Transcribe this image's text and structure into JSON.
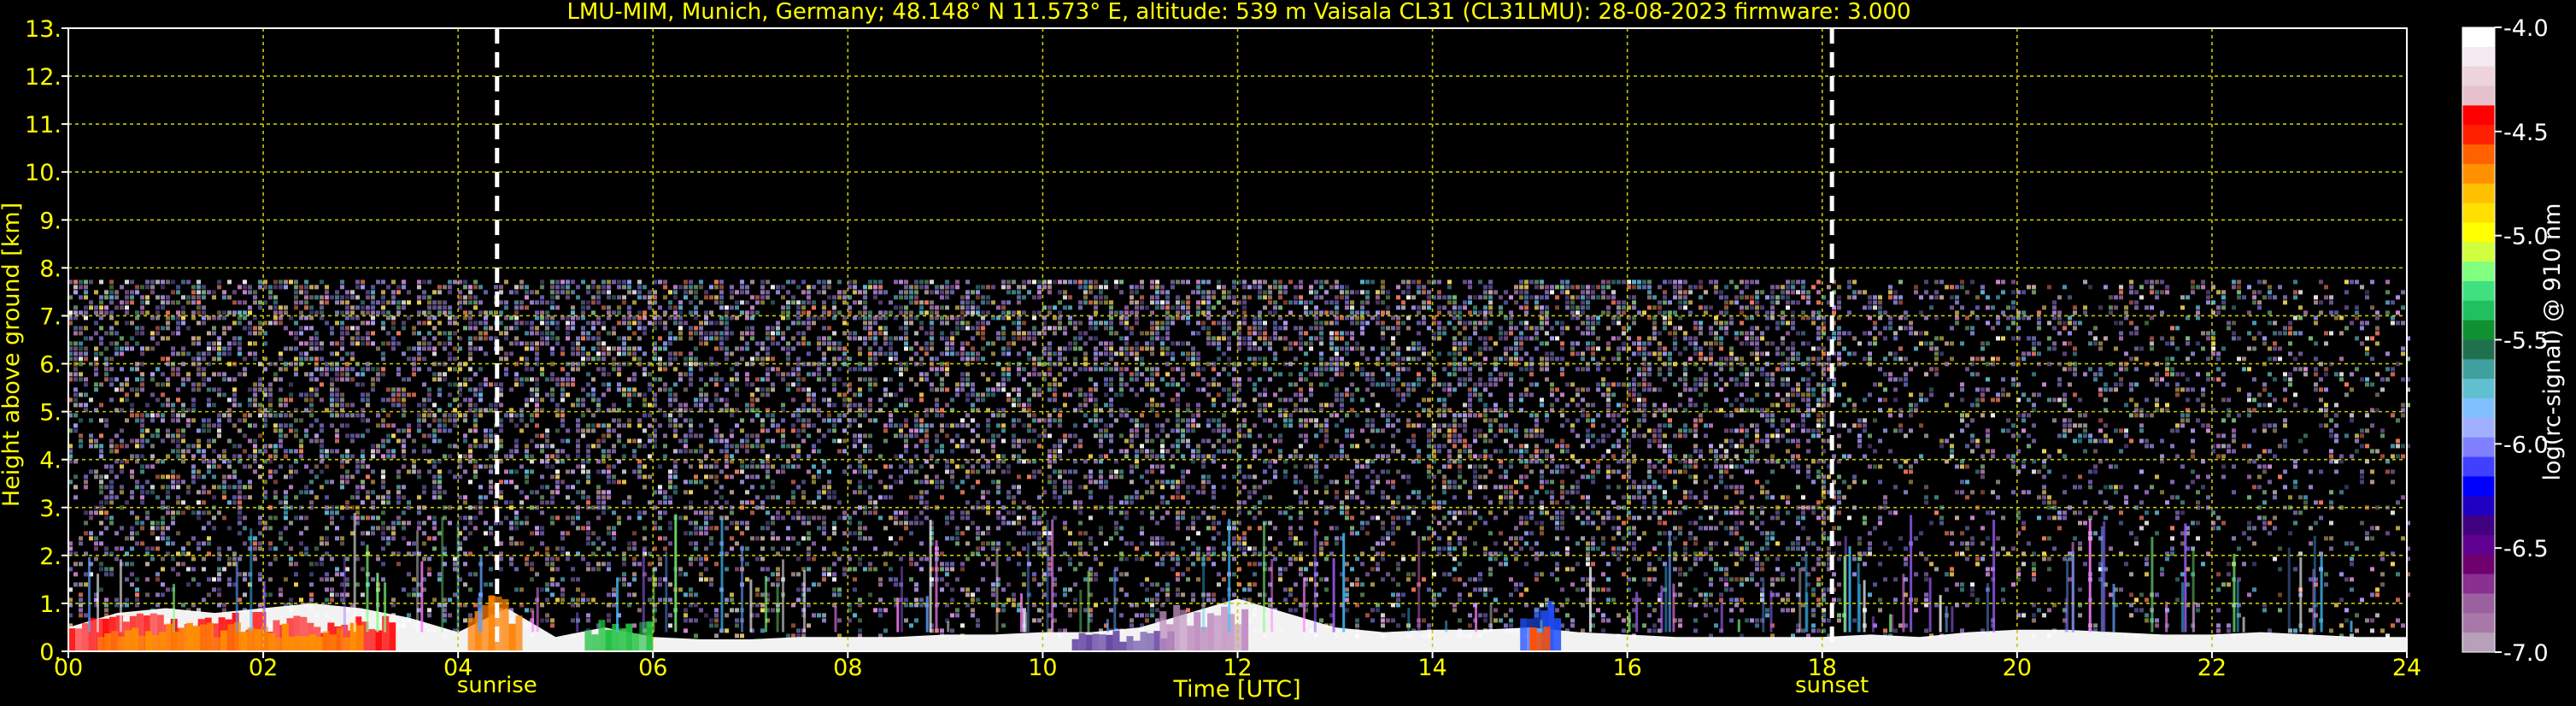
{
  "chart_data": {
    "type": "heatmap",
    "title": "LMU-MIM, Munich, Germany; 48.148° N 11.573° E, altitude: 539 m    Vaisala CL31 (CL31LMU): 28-08-2023    firmware: 3.000",
    "xlabel": "Time [UTC]",
    "ylabel": "Height above ground [km]",
    "xlim": [
      0,
      24
    ],
    "ylim": [
      0,
      13
    ],
    "x_ticks": [
      "00",
      "02",
      "04",
      "06",
      "08",
      "10",
      "12",
      "14",
      "16",
      "18",
      "20",
      "22",
      "24"
    ],
    "y_ticks": [
      "0.",
      "1.",
      "2.",
      "3.",
      "4.",
      "5.",
      "6.",
      "7.",
      "8.",
      "9.",
      "10.",
      "11.",
      "12.",
      "13."
    ],
    "grid": true,
    "colorbar": {
      "label": "log(rc-signal) @ 910 nm",
      "range": [
        -7.0,
        -4.0
      ],
      "ticks": [
        "-4.0",
        "-4.5",
        "-5.0",
        "-5.5",
        "-6.0",
        "-6.5",
        "-7.0"
      ],
      "colors": [
        "#ffffff",
        "#f5eaf0",
        "#ecd3dc",
        "#e6c0cc",
        "#ff0000",
        "#ff2000",
        "#ff6000",
        "#ff9000",
        "#ffc000",
        "#ffe000",
        "#ffff00",
        "#d0ff40",
        "#80ff80",
        "#40e080",
        "#20c060",
        "#109030",
        "#207050",
        "#40a0a0",
        "#60c0d0",
        "#80c0ff",
        "#a0b0ff",
        "#8080ff",
        "#4040ff",
        "#0000ff",
        "#2000c0",
        "#400080",
        "#600090",
        "#700070",
        "#8a3090",
        "#9a60a0",
        "#a878a8",
        "#b8a0b8"
      ]
    },
    "vertical_markers": [
      {
        "label": "sunrise",
        "x": 4.4
      },
      {
        "label": "sunset",
        "x": 18.1
      }
    ],
    "noise_top_km": 7.75,
    "boundary_layer": {
      "x": [
        0,
        0.5,
        1,
        1.5,
        2,
        2.5,
        3,
        3.5,
        4,
        4.5,
        5,
        5.5,
        6,
        6.5,
        7,
        7.5,
        8,
        8.5,
        9,
        9.5,
        10,
        10.5,
        11,
        11.5,
        12,
        12.5,
        13,
        13.5,
        14,
        14.5,
        15,
        15.5,
        16,
        16.5,
        17,
        17.5,
        18,
        18.5,
        19,
        19.5,
        20,
        20.5,
        21,
        21.5,
        22,
        22.5,
        23,
        23.5,
        24
      ],
      "y": [
        0.5,
        0.8,
        0.9,
        0.8,
        0.9,
        1.0,
        0.9,
        0.7,
        0.4,
        0.9,
        0.3,
        0.5,
        0.3,
        0.25,
        0.25,
        0.3,
        0.3,
        0.3,
        0.35,
        0.35,
        0.4,
        0.4,
        0.5,
        0.8,
        1.1,
        0.8,
        0.5,
        0.4,
        0.45,
        0.45,
        0.5,
        0.4,
        0.35,
        0.3,
        0.3,
        0.3,
        0.3,
        0.35,
        0.3,
        0.4,
        0.45,
        0.45,
        0.4,
        0.35,
        0.35,
        0.4,
        0.35,
        0.3,
        0.3
      ]
    }
  }
}
